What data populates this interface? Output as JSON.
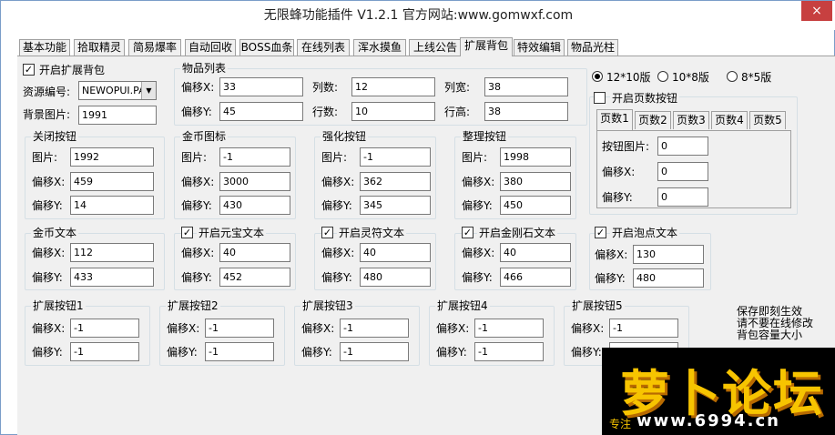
{
  "window": {
    "title": "无限蜂功能插件 V1.2.1  官方网站:www.gomwxf.com",
    "close": "×"
  },
  "tabs": [
    "基本功能",
    "拾取精灵",
    "简易爆率",
    "自动回收",
    "BOSS血条",
    "在线列表",
    "浑水摸鱼",
    "上线公告",
    "扩展背包",
    "特效编辑",
    "物品光柱"
  ],
  "active_tab_index": 8,
  "labels": {
    "offset_x": "偏移X:",
    "offset_y": "偏移Y:",
    "image": "图片:"
  },
  "left_panel": {
    "enable_label": "开启扩展背包",
    "enable_checked": true,
    "resource_label": "资源编号:",
    "resource_value": "NEWOPUI.PA",
    "bg_label": "背景图片:",
    "bg_value": "1991"
  },
  "item_list": {
    "title": "物品列表",
    "offset_x": "33",
    "offset_y": "45",
    "cols_label": "列数:",
    "cols": "12",
    "rows_label": "行数:",
    "rows": "10",
    "colw_label": "列宽:",
    "colw": "38",
    "rowh_label": "行高:",
    "rowh": "38"
  },
  "versions": {
    "options": [
      "12*10版",
      "10*8版",
      "8*5版"
    ],
    "selected": 0
  },
  "page_buttons": {
    "enable_label": "开启页数按钮",
    "enable_checked": false,
    "tabs": [
      "页数1",
      "页数2",
      "页数3",
      "页数4",
      "页数5"
    ],
    "active": 0,
    "image_label": "按钮图片:",
    "image": "0",
    "offset_x": "0",
    "offset_y": "0"
  },
  "close_button": {
    "title": "关闭按钮",
    "image": "1992",
    "offset_x": "459",
    "offset_y": "14"
  },
  "gold_icon": {
    "title": "金币图标",
    "image": "-1",
    "offset_x": "3000",
    "offset_y": "430"
  },
  "enhance_button": {
    "title": "强化按钮",
    "image": "-1",
    "offset_x": "362",
    "offset_y": "345"
  },
  "sort_button": {
    "title": "整理按钮",
    "image": "1998",
    "offset_x": "380",
    "offset_y": "450"
  },
  "gold_text": {
    "title": "金币文本",
    "offset_x": "112",
    "offset_y": "433"
  },
  "yuanbao_text": {
    "title": "开启元宝文本",
    "checked": true,
    "offset_x": "40",
    "offset_y": "452"
  },
  "lingfu_text": {
    "title": "开启灵符文本",
    "checked": true,
    "offset_x": "40",
    "offset_y": "480"
  },
  "diamond_text": {
    "title": "开启金刚石文本",
    "checked": true,
    "offset_x": "40",
    "offset_y": "466"
  },
  "bubble_text": {
    "title": "开启泡点文本",
    "checked": true,
    "offset_x": "130",
    "offset_y": "480"
  },
  "ext_buttons": [
    {
      "title": "扩展按钮1",
      "offset_x": "-1",
      "offset_y": "-1"
    },
    {
      "title": "扩展按钮2",
      "offset_x": "-1",
      "offset_y": "-1"
    },
    {
      "title": "扩展按钮3",
      "offset_x": "-1",
      "offset_y": "-1"
    },
    {
      "title": "扩展按钮4",
      "offset_x": "-1",
      "offset_y": "-1"
    },
    {
      "title": "扩展按钮5",
      "offset_x": "-1",
      "offset_y": "-1"
    }
  ],
  "note": [
    "保存即刻生效",
    "请不要在线修改",
    "背包容量大小"
  ],
  "watermark": {
    "text": "萝卜论坛",
    "url": "www.6994.cn",
    "sub": "专注"
  }
}
